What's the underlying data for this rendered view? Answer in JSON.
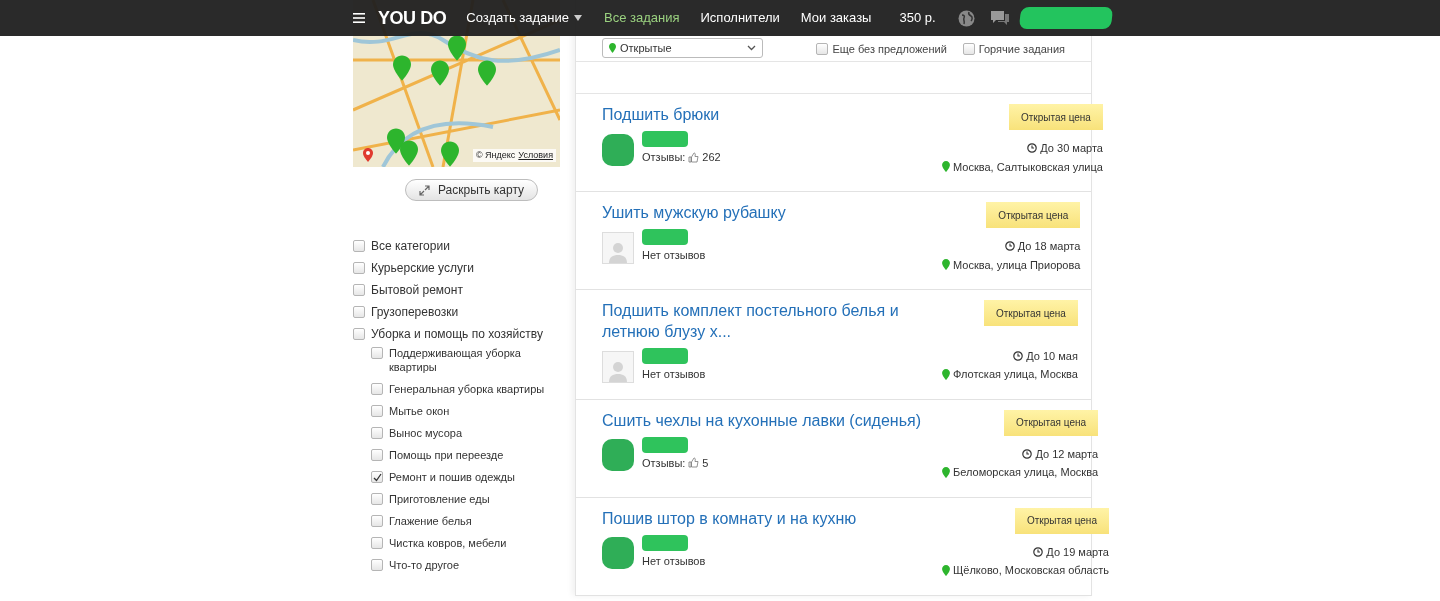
{
  "header": {
    "logo": "YOU DO",
    "nav": [
      {
        "label": "Создать задание",
        "kind": "dropdown",
        "selected": false
      },
      {
        "label": "Все задания",
        "kind": "link",
        "selected": true
      },
      {
        "label": "Исполнители",
        "kind": "link",
        "selected": false
      },
      {
        "label": "Мои заказы",
        "kind": "link",
        "selected": false
      }
    ],
    "balance": "350 р."
  },
  "map": {
    "attribution": "© Яндекс",
    "terms_link": "Условия"
  },
  "expand_map_button": "Раскрыть карту",
  "categories": [
    {
      "label": "Все категории",
      "checked": false
    },
    {
      "label": "Курьерские услуги",
      "checked": false
    },
    {
      "label": "Бытовой ремонт",
      "checked": false
    },
    {
      "label": "Грузоперевозки",
      "checked": false
    },
    {
      "label": "Уборка и помощь по хозяйству",
      "checked": false,
      "children": [
        {
          "label": "Поддерживающая уборка квартиры",
          "checked": false
        },
        {
          "label": "Генеральная уборка квартиры",
          "checked": false
        },
        {
          "label": "Мытье окон",
          "checked": false
        },
        {
          "label": "Вынос мусора",
          "checked": false
        },
        {
          "label": "Помощь при переезде",
          "checked": false
        },
        {
          "label": "Ремонт и пошив одежды",
          "checked": true
        },
        {
          "label": "Приготовление еды",
          "checked": false
        },
        {
          "label": "Глажение белья",
          "checked": false
        },
        {
          "label": "Чистка ковров, мебели",
          "checked": false
        },
        {
          "label": "Что-то другое",
          "checked": false
        }
      ]
    }
  ],
  "filters": {
    "status": "Открытые",
    "options": [
      {
        "label": "Еще без предложений",
        "checked": false
      },
      {
        "label": "Горячие задания",
        "checked": false
      }
    ]
  },
  "tasks": [
    {
      "title": "Подшить брюки",
      "price": "Открытая цена",
      "kind": "photo",
      "reviews": "Отзывы:",
      "review_count": "262",
      "deadline": "До 30 марта",
      "location": "Москва, Салтыковская улица"
    },
    {
      "title": "Ушить мужскую рубашку",
      "price": "Открытая цена",
      "kind": "placeholder",
      "reviews": "Нет отзывов",
      "deadline": "До 18 марта",
      "location": "Москва, улица Приорова"
    },
    {
      "title": "Подшить комплект постельного белья и летнюю блузу х...",
      "price": "Открытая цена",
      "kind": "placeholder",
      "reviews": "Нет отзывов",
      "deadline": "До 10 мая",
      "location": "Флотская улица, Москва"
    },
    {
      "title": "Сшить чехлы на кухонные лавки (сиденья)",
      "price": "Открытая цена",
      "kind": "photo",
      "reviews": "Отзывы:",
      "review_count": "5",
      "deadline": "До 12 марта",
      "location": "Беломорская улица, Москва"
    },
    {
      "title": "Пошив штор в комнату и на кухню",
      "price": "Открытая цена",
      "kind": "photo",
      "reviews": "Нет отзывов",
      "deadline": "До 19 марта",
      "location": "Щёлково, Московская область"
    }
  ]
}
